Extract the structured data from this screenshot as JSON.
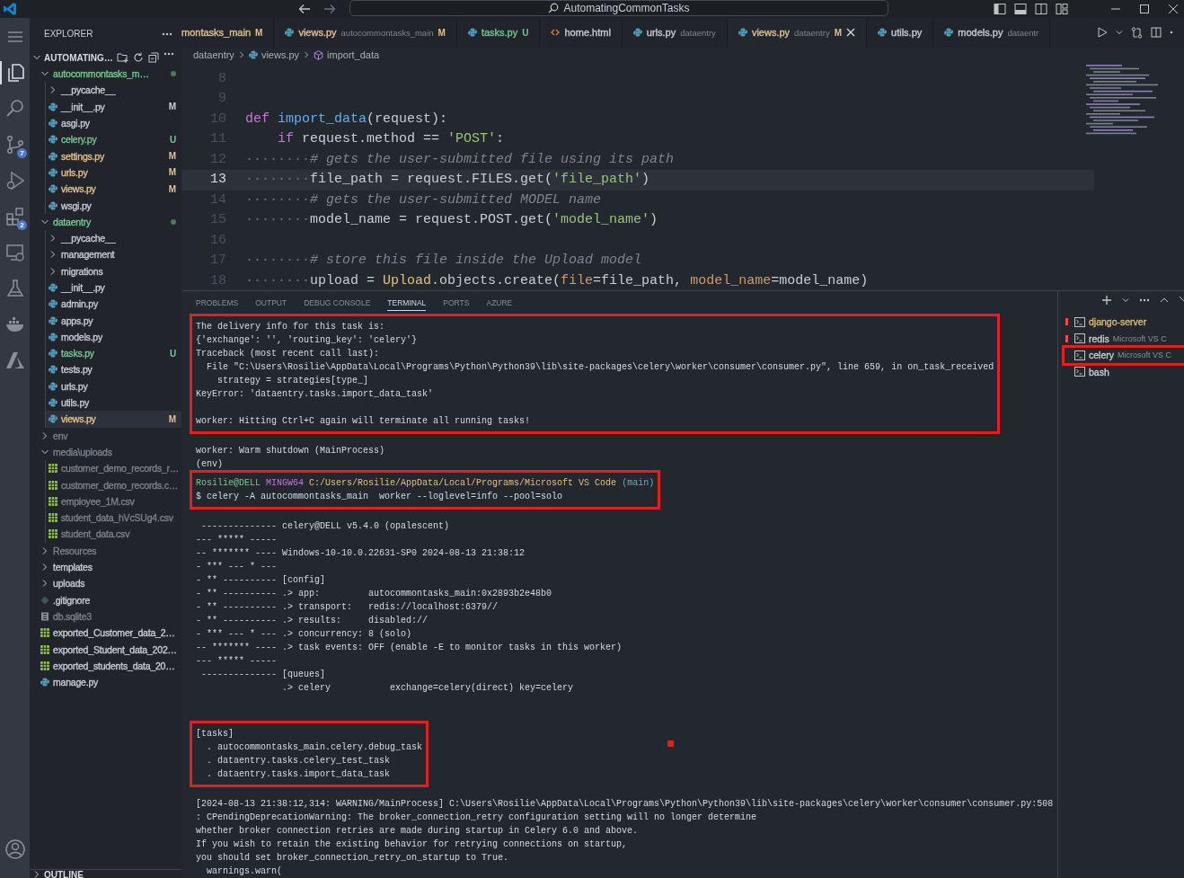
{
  "title_bar": {
    "search_text": "AutomatingCommonTasks"
  },
  "activity_bar": [
    {
      "kind": "menu",
      "selected": false
    },
    {
      "kind": "explorer",
      "selected": true
    },
    {
      "kind": "search",
      "selected": false
    },
    {
      "kind": "source-control",
      "selected": false,
      "badge": "7"
    },
    {
      "kind": "run-debug",
      "selected": false
    },
    {
      "kind": "extensions",
      "selected": false,
      "badge": "2"
    },
    {
      "kind": "remote",
      "selected": false
    },
    {
      "kind": "testing",
      "selected": false
    },
    {
      "kind": "docker",
      "selected": false
    },
    {
      "kind": "azure",
      "selected": false
    }
  ],
  "explorer": {
    "title": "EXPLORER",
    "root": "AUTOMATING…",
    "tree": [
      {
        "name": "autocommontasks_m…",
        "kind": "folder",
        "expanded": true,
        "color": "#73c991",
        "dot": true,
        "selected": false,
        "children": [
          {
            "name": "__pycache__",
            "kind": "folder",
            "expanded": false,
            "color": "#c8ccd4",
            "selected": false
          },
          {
            "name": "__init__.py",
            "kind": "python",
            "color": "#c8ccd4",
            "badge": "M",
            "selected": false
          },
          {
            "name": "asgi.py",
            "kind": "python",
            "color": "#c8ccd4",
            "selected": false
          },
          {
            "name": "celery.py",
            "kind": "python",
            "color": "#73c991",
            "badge": "U",
            "selected": false
          },
          {
            "name": "settings.py",
            "kind": "python",
            "color": "#e2c08d",
            "badge": "M",
            "selected": false
          },
          {
            "name": "urls.py",
            "kind": "python",
            "color": "#e2c08d",
            "badge": "M",
            "selected": false
          },
          {
            "name": "views.py",
            "kind": "python",
            "color": "#e2c08d",
            "badge": "M",
            "selected": false
          },
          {
            "name": "wsgi.py",
            "kind": "python",
            "color": "#c8ccd4",
            "selected": false
          }
        ]
      },
      {
        "name": "dataentry",
        "kind": "folder",
        "expanded": true,
        "color": "#73c991",
        "dot": true,
        "selected": false,
        "children": [
          {
            "name": "__pycache__",
            "kind": "folder",
            "expanded": false,
            "color": "#c8ccd4",
            "selected": false
          },
          {
            "name": "management",
            "kind": "folder",
            "expanded": false,
            "color": "#c8ccd4",
            "selected": false
          },
          {
            "name": "migrations",
            "kind": "folder",
            "expanded": false,
            "color": "#c8ccd4",
            "selected": false
          },
          {
            "name": "__init__.py",
            "kind": "python",
            "color": "#c8ccd4",
            "selected": false
          },
          {
            "name": "admin.py",
            "kind": "python",
            "color": "#c8ccd4",
            "selected": false
          },
          {
            "name": "apps.py",
            "kind": "python",
            "color": "#c8ccd4",
            "selected": false
          },
          {
            "name": "models.py",
            "kind": "python",
            "color": "#c8ccd4",
            "selected": false
          },
          {
            "name": "tasks.py",
            "kind": "python",
            "color": "#73c991",
            "badge": "U",
            "selected": false
          },
          {
            "name": "tests.py",
            "kind": "python",
            "color": "#c8ccd4",
            "selected": false
          },
          {
            "name": "urls.py",
            "kind": "python",
            "color": "#c8ccd4",
            "selected": false
          },
          {
            "name": "utils.py",
            "kind": "python",
            "color": "#c8ccd4",
            "selected": false
          },
          {
            "name": "views.py",
            "kind": "python",
            "color": "#e2c08d",
            "badge": "M",
            "selected": true
          }
        ]
      },
      {
        "name": "env",
        "kind": "folder",
        "expanded": false,
        "color": "#7b818c",
        "selected": false
      },
      {
        "name": "media\\uploads",
        "kind": "folder",
        "expanded": true,
        "color": "#7b818c",
        "selected": false,
        "children": [
          {
            "name": "customer_demo_records_r…",
            "kind": "csv",
            "color": "#7b818c",
            "selected": false
          },
          {
            "name": "customer_demo_records.c…",
            "kind": "csv",
            "color": "#7b818c",
            "selected": false
          },
          {
            "name": "employee_1M.csv",
            "kind": "csv",
            "color": "#7b818c",
            "selected": false
          },
          {
            "name": "student_data_hVcSUg4.csv",
            "kind": "csv",
            "color": "#7b818c",
            "selected": false
          },
          {
            "name": "student_data.csv",
            "kind": "csv",
            "color": "#7b818c",
            "selected": false
          }
        ]
      },
      {
        "name": "Resources",
        "kind": "folder",
        "expanded": false,
        "color": "#7b818c",
        "selected": false
      },
      {
        "name": "templates",
        "kind": "folder",
        "expanded": false,
        "color": "#c8ccd4",
        "selected": false
      },
      {
        "name": "uploads",
        "kind": "folder",
        "expanded": false,
        "color": "#c8ccd4",
        "selected": false
      },
      {
        "name": ".gitignore",
        "kind": "git",
        "color": "#c8ccd4",
        "selected": false
      },
      {
        "name": "db.sqlite3",
        "kind": "db",
        "color": "#7b818c",
        "selected": false
      },
      {
        "name": "exported_Customer_data_2…",
        "kind": "csv",
        "color": "#c8ccd4",
        "selected": false
      },
      {
        "name": "exported_Student_data_202…",
        "kind": "csv",
        "color": "#c8ccd4",
        "selected": false
      },
      {
        "name": "exported_students_data_20…",
        "kind": "csv",
        "color": "#c8ccd4",
        "selected": false
      },
      {
        "name": "manage.py",
        "kind": "python",
        "color": "#c8ccd4",
        "selected": false
      }
    ],
    "outline": "OUTLINE"
  },
  "tabs": [
    {
      "name": "montasks_main",
      "badge": "M",
      "kind": "plain",
      "color": "#e2c08d",
      "selected": false
    },
    {
      "name": "views.py",
      "detail": "autocommontasks_main",
      "badge": "M",
      "kind": "python",
      "color": "#e2c08d",
      "selected": false
    },
    {
      "name": "tasks.py",
      "badge": "U",
      "kind": "python",
      "color": "#73c991",
      "selected": false
    },
    {
      "name": "home.html",
      "kind": "html",
      "color": "#c8ccd4",
      "selected": false
    },
    {
      "name": "urls.py",
      "detail": "dataentry",
      "kind": "python",
      "color": "#c8ccd4",
      "selected": false
    },
    {
      "name": "views.py",
      "detail": "dataentry",
      "badge": "M",
      "kind": "python",
      "color": "#e2c08d",
      "selected": true
    },
    {
      "name": "utils.py",
      "kind": "python",
      "color": "#c8ccd4",
      "selected": false
    },
    {
      "name": "models.py",
      "detail": "dataentr",
      "kind": "python",
      "color": "#c8ccd4",
      "selected": false
    }
  ],
  "breadcrumb": [
    {
      "text": "dataentry",
      "kind": "folder"
    },
    {
      "text": "views.py",
      "kind": "python"
    },
    {
      "text": "import_data",
      "kind": "function"
    }
  ],
  "code": [
    {
      "number": "8",
      "current": false
    },
    {
      "number": "9",
      "current": false
    },
    {
      "number": "10",
      "current": false,
      "tokens": [
        {
          "t": "def ",
          "kind": "kw"
        },
        {
          "t": "import_data",
          "kind": "fn"
        },
        {
          "t": "(request):",
          "kind": "plain"
        }
      ]
    },
    {
      "number": "11",
      "current": false,
      "tokens": [
        {
          "t": "    if ",
          "kind": "kw"
        },
        {
          "t": "request.method == ",
          "kind": "plain"
        },
        {
          "t": "'POST'",
          "kind": "str"
        },
        {
          "t": ":",
          "kind": "plain"
        }
      ]
    },
    {
      "number": "12",
      "current": false,
      "tokens": [
        {
          "t": "········",
          "kind": "ws"
        },
        {
          "t": "# gets the user-submitted file using its path",
          "kind": "cm"
        }
      ]
    },
    {
      "number": "13",
      "current": true,
      "tokens": [
        {
          "t": "········",
          "kind": "ws"
        },
        {
          "t": "file_path = request.FILES.get(",
          "kind": "plain"
        },
        {
          "t": "'file_path'",
          "kind": "str"
        },
        {
          "t": ")",
          "kind": "plain"
        }
      ]
    },
    {
      "number": "14",
      "current": false,
      "tokens": [
        {
          "t": "········",
          "kind": "ws"
        },
        {
          "t": "# gets the user-submitted MODEL name",
          "kind": "cm"
        }
      ]
    },
    {
      "number": "15",
      "current": false,
      "tokens": [
        {
          "t": "········",
          "kind": "ws"
        },
        {
          "t": "model_name = request.POST.get(",
          "kind": "plain"
        },
        {
          "t": "'model_name'",
          "kind": "str"
        },
        {
          "t": ")",
          "kind": "plain"
        }
      ]
    },
    {
      "number": "16",
      "current": false
    },
    {
      "number": "17",
      "current": false,
      "tokens": [
        {
          "t": "········",
          "kind": "ws"
        },
        {
          "t": "# store this file inside the Upload model",
          "kind": "cm"
        }
      ]
    },
    {
      "number": "18",
      "current": false,
      "tokens": [
        {
          "t": "········",
          "kind": "ws"
        },
        {
          "t": "upload = ",
          "kind": "plain"
        },
        {
          "t": "Upload",
          "kind": "cls"
        },
        {
          "t": ".objects.create(",
          "kind": "plain"
        },
        {
          "t": "file",
          "kind": "arg"
        },
        {
          "t": "=file_path, ",
          "kind": "plain"
        },
        {
          "t": "model_name",
          "kind": "arg"
        },
        {
          "t": "=model_name)",
          "kind": "plain"
        }
      ]
    }
  ],
  "panel": {
    "tabs": [
      {
        "label": "PROBLEMS",
        "selected": false
      },
      {
        "label": "OUTPUT",
        "selected": false
      },
      {
        "label": "DEBUG CONSOLE",
        "selected": false
      },
      {
        "label": "TERMINAL",
        "selected": true
      },
      {
        "label": "PORTS",
        "selected": false
      },
      {
        "label": "AZURE",
        "selected": false
      }
    ],
    "annotation_mark": true,
    "terminal": [
      {
        "highlighted": true,
        "lines": [
          {
            "kind": "text",
            "text": "The delivery info for this task is:"
          },
          {
            "kind": "text",
            "text": "{'exchange': '', 'routing_key': 'celery'}"
          },
          {
            "kind": "text",
            "text": "Traceback (most recent call last):"
          },
          {
            "kind": "text",
            "text": "  File \"C:\\Users\\Rosilie\\AppData\\Local\\Programs\\Python\\Python39\\lib\\site-packages\\celery\\worker\\consumer\\consumer.py\", line 659, in on_task_received"
          },
          {
            "kind": "text",
            "text": "    strategy = strategies[type_]"
          },
          {
            "kind": "text",
            "text": "KeyError: 'dataentry.tasks.import_data_task'"
          },
          {
            "kind": "blank"
          },
          {
            "kind": "text",
            "text": "worker: Hitting Ctrl+C again will terminate all running tasks!"
          }
        ]
      },
      {
        "highlighted": false,
        "lines": [
          {
            "kind": "blank"
          },
          {
            "kind": "text",
            "text": "worker: Warm shutdown (MainProcess)"
          },
          {
            "kind": "text",
            "text": "(env)"
          }
        ]
      },
      {
        "highlighted": true,
        "lines": [
          {
            "kind": "prompt",
            "user": "Rosilie@DELL",
            "shell": "MINGW64",
            "path": "C:/Users/Rosilie/AppData/Local/Programs/Microsoft VS Code",
            "branch": "(main)"
          },
          {
            "kind": "text",
            "text": "$ celery -A autocommontasks_main  worker --loglevel=info --pool=solo"
          }
        ]
      },
      {
        "highlighted": false,
        "lines": [
          {
            "kind": "blank"
          },
          {
            "kind": "text",
            "text": " -------------- celery@DELL v5.4.0 (opalescent)"
          },
          {
            "kind": "text",
            "text": "--- ***** -----"
          },
          {
            "kind": "text",
            "text": "-- ******* ---- Windows-10-10.0.22631-SP0 2024-08-13 21:38:12"
          },
          {
            "kind": "text",
            "text": "- *** --- * ---"
          },
          {
            "kind": "text",
            "text": "- ** ---------- [config]"
          },
          {
            "kind": "text",
            "text": "- ** ---------- .> app:         autocommontasks_main:0x2893b2e48b0"
          },
          {
            "kind": "text",
            "text": "- ** ---------- .> transport:   redis://localhost:6379//"
          },
          {
            "kind": "text",
            "text": "- ** ---------- .> results:     disabled://"
          },
          {
            "kind": "text",
            "text": "- *** --- * --- .> concurrency: 8 (solo)"
          },
          {
            "kind": "text",
            "text": "-- ******* ---- .> task events: OFF (enable -E to monitor tasks in this worker)"
          },
          {
            "kind": "text",
            "text": "--- ***** -----"
          },
          {
            "kind": "text",
            "text": " -------------- [queues]"
          },
          {
            "kind": "text",
            "text": "                .> celery           exchange=celery(direct) key=celery"
          },
          {
            "kind": "blank"
          },
          {
            "kind": "blank"
          }
        ]
      },
      {
        "highlighted": true,
        "lines": [
          {
            "kind": "text",
            "text": "[tasks]"
          },
          {
            "kind": "text",
            "text": "  . autocommontasks_main.celery.debug_task"
          },
          {
            "kind": "text",
            "text": "  . dataentry.tasks.celery_test_task"
          },
          {
            "kind": "text",
            "text": "  . dataentry.tasks.import_data_task"
          }
        ]
      },
      {
        "highlighted": false,
        "lines": [
          {
            "kind": "blank"
          },
          {
            "kind": "text",
            "text": "[2024-08-13 21:38:12,314: WARNING/MainProcess] C:\\Users\\Rosilie\\AppData\\Local\\Programs\\Python\\Python39\\lib\\site-packages\\celery\\worker\\consumer\\consumer.py:508"
          },
          {
            "kind": "text",
            "text": ": CPendingDeprecationWarning: The broker_connection_retry configuration setting will no longer determine"
          },
          {
            "kind": "text",
            "text": "whether broker connection retries are made during startup in Celery 6.0 and above."
          },
          {
            "kind": "text",
            "text": "If you wish to retain the existing behavior for retrying connections on startup,"
          },
          {
            "kind": "text",
            "text": "you should set broker_connection_retry_on_startup to True."
          },
          {
            "kind": "text",
            "text": "  warnings.warn("
          }
        ]
      }
    ],
    "terminals": [
      {
        "name": "django-server",
        "color": "#d7ba7d",
        "marker": true,
        "highlighted": false
      },
      {
        "name": "redis",
        "detail": "Microsoft VS C",
        "color": "#c8ccd4",
        "marker": true,
        "highlighted": false
      },
      {
        "name": "celery",
        "detail": "Microsoft VS C",
        "color": "#c8ccd4",
        "marker": false,
        "highlighted": true
      },
      {
        "name": "bash",
        "color": "#c8ccd4",
        "marker": false,
        "highlighted": false
      }
    ]
  }
}
